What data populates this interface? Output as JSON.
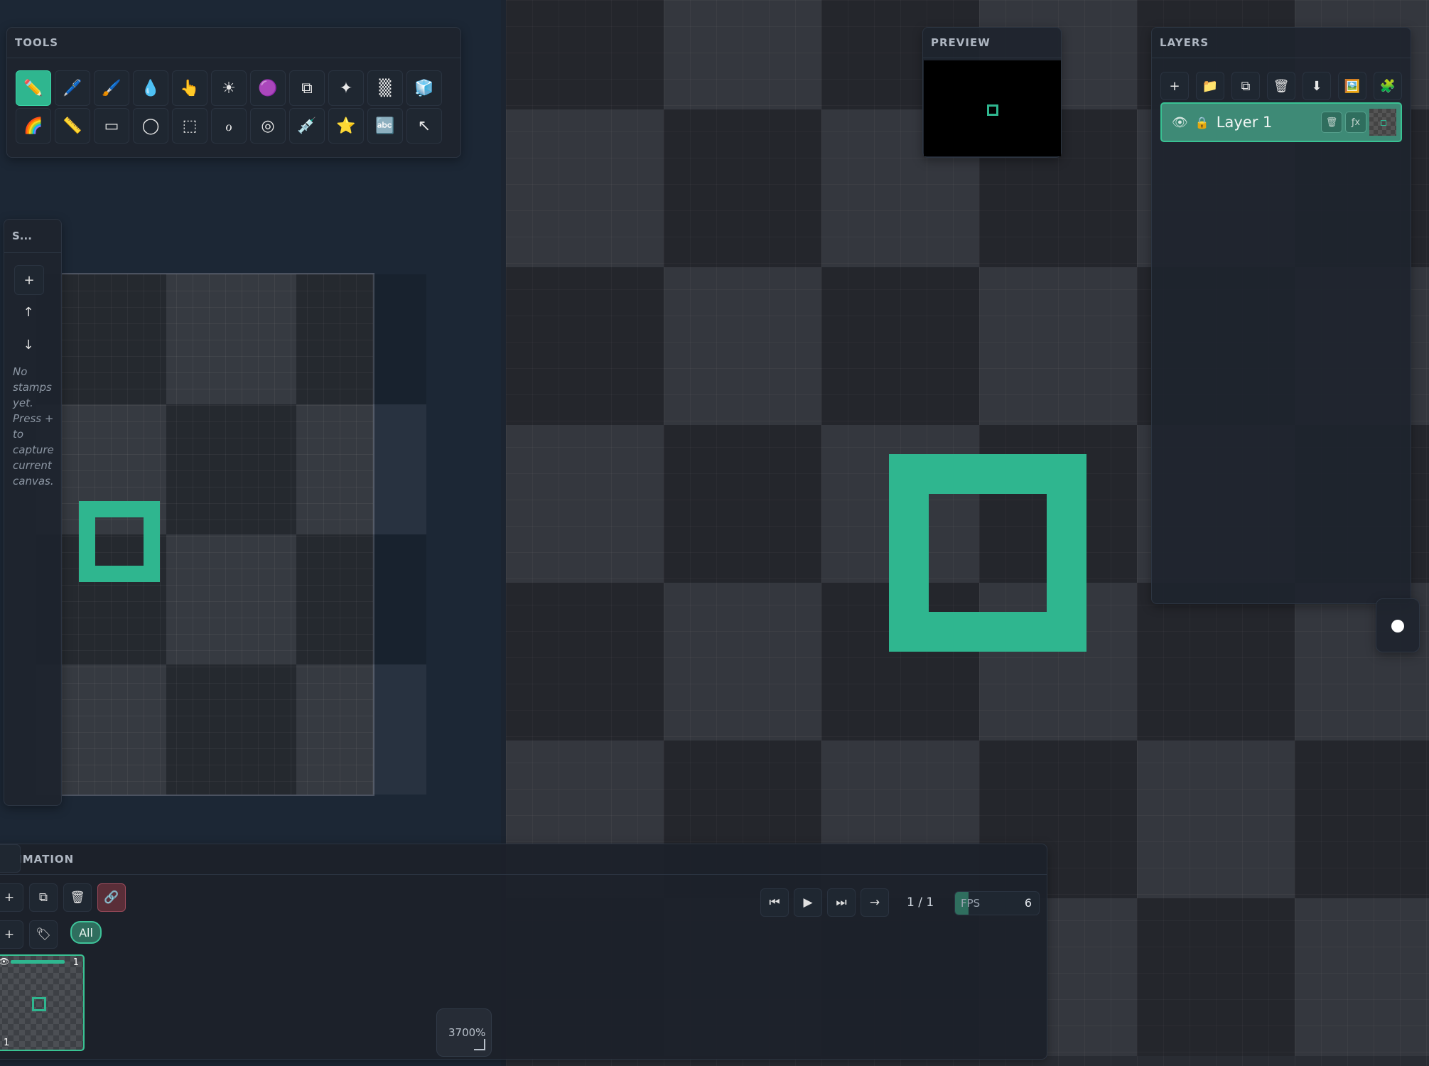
{
  "tools_panel": {
    "title": "TOOLS",
    "tools": [
      {
        "name": "pencil-tool",
        "glyph": "✏️"
      },
      {
        "name": "pen-tool",
        "glyph": "🖊️"
      },
      {
        "name": "brush-tool",
        "glyph": "🖌️"
      },
      {
        "name": "fill-tool",
        "glyph": "💧"
      },
      {
        "name": "smudge-tool",
        "glyph": "👆"
      },
      {
        "name": "lighten-tool",
        "glyph": "☀"
      },
      {
        "name": "sphere-tool",
        "glyph": "🟣"
      },
      {
        "name": "clone-tool",
        "glyph": "⧉"
      },
      {
        "name": "sparkle-tool",
        "glyph": "✦"
      },
      {
        "name": "dither-tool",
        "glyph": "▒"
      },
      {
        "name": "gradient-tool",
        "glyph": "🧊"
      },
      {
        "name": "rainbow-tool",
        "glyph": "🌈"
      },
      {
        "name": "line-tool",
        "glyph": "📏"
      },
      {
        "name": "rectangle-tool",
        "glyph": "▭"
      },
      {
        "name": "ellipse-tool",
        "glyph": "◯"
      },
      {
        "name": "selection-tool",
        "glyph": "⬚"
      },
      {
        "name": "lasso-tool",
        "glyph": "ℴ"
      },
      {
        "name": "spiral-tool",
        "glyph": "◎"
      },
      {
        "name": "eyedropper-tool",
        "glyph": "💉"
      },
      {
        "name": "star-tool",
        "glyph": "⭐"
      },
      {
        "name": "text-tool",
        "glyph": "🔤"
      },
      {
        "name": "move-tool",
        "glyph": "↖"
      }
    ]
  },
  "preview_panel": {
    "title": "PREVIEW"
  },
  "layers_panel": {
    "title": "LAYERS",
    "toolbar": [
      {
        "name": "add-layer-button",
        "glyph": "+"
      },
      {
        "name": "add-group-button",
        "glyph": "📁"
      },
      {
        "name": "duplicate-layer-button",
        "glyph": "⧉"
      },
      {
        "name": "delete-layer-button",
        "glyph": "🗑"
      },
      {
        "name": "merge-down-button",
        "glyph": "⬇"
      },
      {
        "name": "import-image-button",
        "glyph": "🖼️"
      },
      {
        "name": "plugin-button",
        "glyph": "🧩"
      }
    ],
    "layers": [
      {
        "name": "Layer 1",
        "visible": true,
        "locked": false
      }
    ],
    "layer_glyphs": {
      "eye": "👁",
      "lock": "🔒",
      "delete": "🗑",
      "fx": "ƒx"
    }
  },
  "stamps_panel": {
    "title": "S...",
    "add_glyph": "+",
    "up_glyph": "↑",
    "down_glyph": "↓",
    "empty_message": "No stamps yet. Press + to capture current canvas."
  },
  "animation_panel": {
    "title": "ANIMATION",
    "row1": [
      {
        "name": "add-frame-button",
        "glyph": "+"
      },
      {
        "name": "duplicate-frame-button",
        "glyph": "⧉"
      },
      {
        "name": "delete-frame-button",
        "glyph": "🗑"
      },
      {
        "name": "link-frames-button",
        "glyph": "🔗"
      }
    ],
    "row2": [
      {
        "name": "add-tag-button",
        "glyph": "+"
      },
      {
        "name": "tag-button",
        "glyph": "🏷"
      }
    ],
    "filter_all": "All",
    "playback": [
      {
        "name": "first-frame-button",
        "glyph": "⏮"
      },
      {
        "name": "play-button",
        "glyph": "▶"
      },
      {
        "name": "last-frame-button",
        "glyph": "⏭"
      },
      {
        "name": "next-frame-button",
        "glyph": "→"
      }
    ],
    "frame_counter": "1 / 1",
    "fps_label": "FPS",
    "fps_value": "6",
    "fps_fill_fraction": 0.16,
    "frame": {
      "index_top": "1",
      "index_bottom": "1",
      "eye": "👁"
    }
  },
  "zoom": {
    "level": "3700%"
  },
  "colors": {
    "accent": "#2fb68f",
    "link_button": "#5a2e38"
  }
}
